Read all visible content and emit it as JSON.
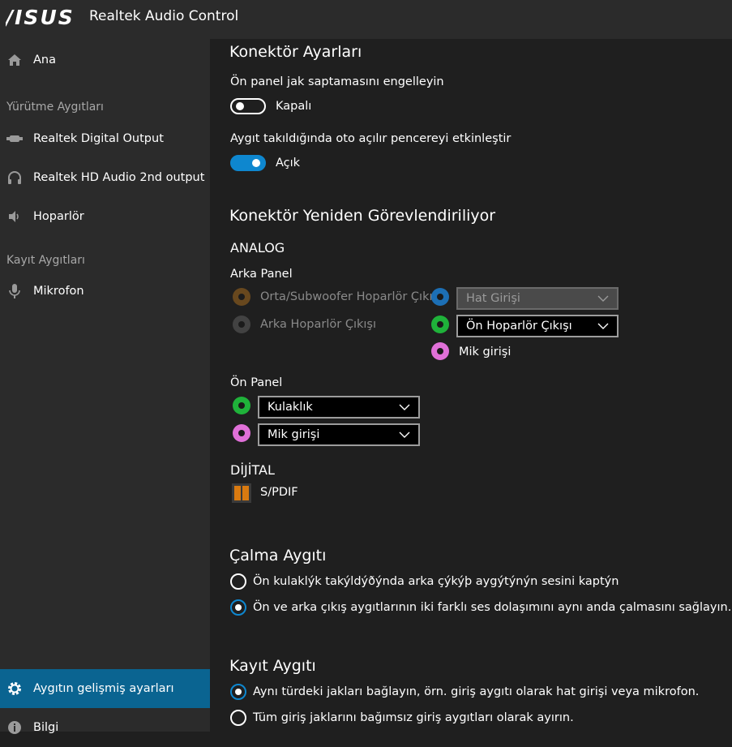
{
  "window": {
    "brand": "/ISUS",
    "title": "Realtek Audio Control"
  },
  "sidebar": {
    "home": "Ana",
    "playback_header": "Yürütme Aygıtları",
    "playback": [
      "Realtek Digital Output",
      "Realtek HD Audio 2nd output",
      "Hoparlör"
    ],
    "recording_header": "Kayıt Aygıtları",
    "recording": [
      "Mikrofon"
    ],
    "advanced": "Aygıtın gelişmiş ayarları",
    "info": "Bilgi"
  },
  "connector_settings": {
    "title": "Konektör Ayarları",
    "front_jack_label": "Ön panel jak saptamasını engelleyin",
    "front_jack_state": "Kapalı",
    "front_jack_on": false,
    "popup_label": "Aygıt takıldığında oto açılır pencereyi etkinleştir",
    "popup_state": "Açık",
    "popup_on": true
  },
  "retasking": {
    "title": "Konektör Yeniden Görevlendiriliyor",
    "analog": "ANALOG",
    "rear_panel": "Arka Panel",
    "rear_left": [
      "Orta/Subwoofer Hoparlör Çıkışı",
      "Arka Hoparlör Çıkışı"
    ],
    "rear_selects": [
      "Hat Girişi",
      "Ön Hoparlör Çıkışı"
    ],
    "rear_mic": "Mik girişi",
    "front_panel": "Ön Panel",
    "front_selects": [
      "Kulaklık",
      "Mik girişi"
    ],
    "digital": "DİJİTAL",
    "spdif": "S/PDIF"
  },
  "playback_device": {
    "title": "Çalma Aygıtı",
    "options": [
      "Ön kulaklýk takýldýðýnda arka çýkýþ aygýtýnýn sesini kaptýn",
      "Ön ve arka çıkış aygıtlarının iki farklı ses dolaşımını aynı anda çalmasını sağlayın."
    ],
    "selected": 1
  },
  "recording_device": {
    "title": "Kayıt Aygıtı",
    "options": [
      "Aynı türdeki jakları bağlayın, örn. giriş aygıtı olarak hat girişi veya mikrofon.",
      "Tüm giriş jaklarını bağımsız giriş aygıtları olarak ayırın."
    ],
    "selected": 0
  },
  "colors": {
    "accent": "#0e87cf",
    "sidebar_active": "#0a6491",
    "jack_orange": "#c27a1e",
    "jack_gray": "#5a5a5a",
    "jack_blue": "#1c6fb5",
    "jack_green": "#1fb23a",
    "jack_pink": "#e070d8"
  },
  "icons": [
    "home-icon",
    "digital-output-icon",
    "headphones-icon",
    "speaker-icon",
    "microphone-icon",
    "gear-icon",
    "info-icon",
    "chevron-down-icon",
    "spdif-icon"
  ]
}
